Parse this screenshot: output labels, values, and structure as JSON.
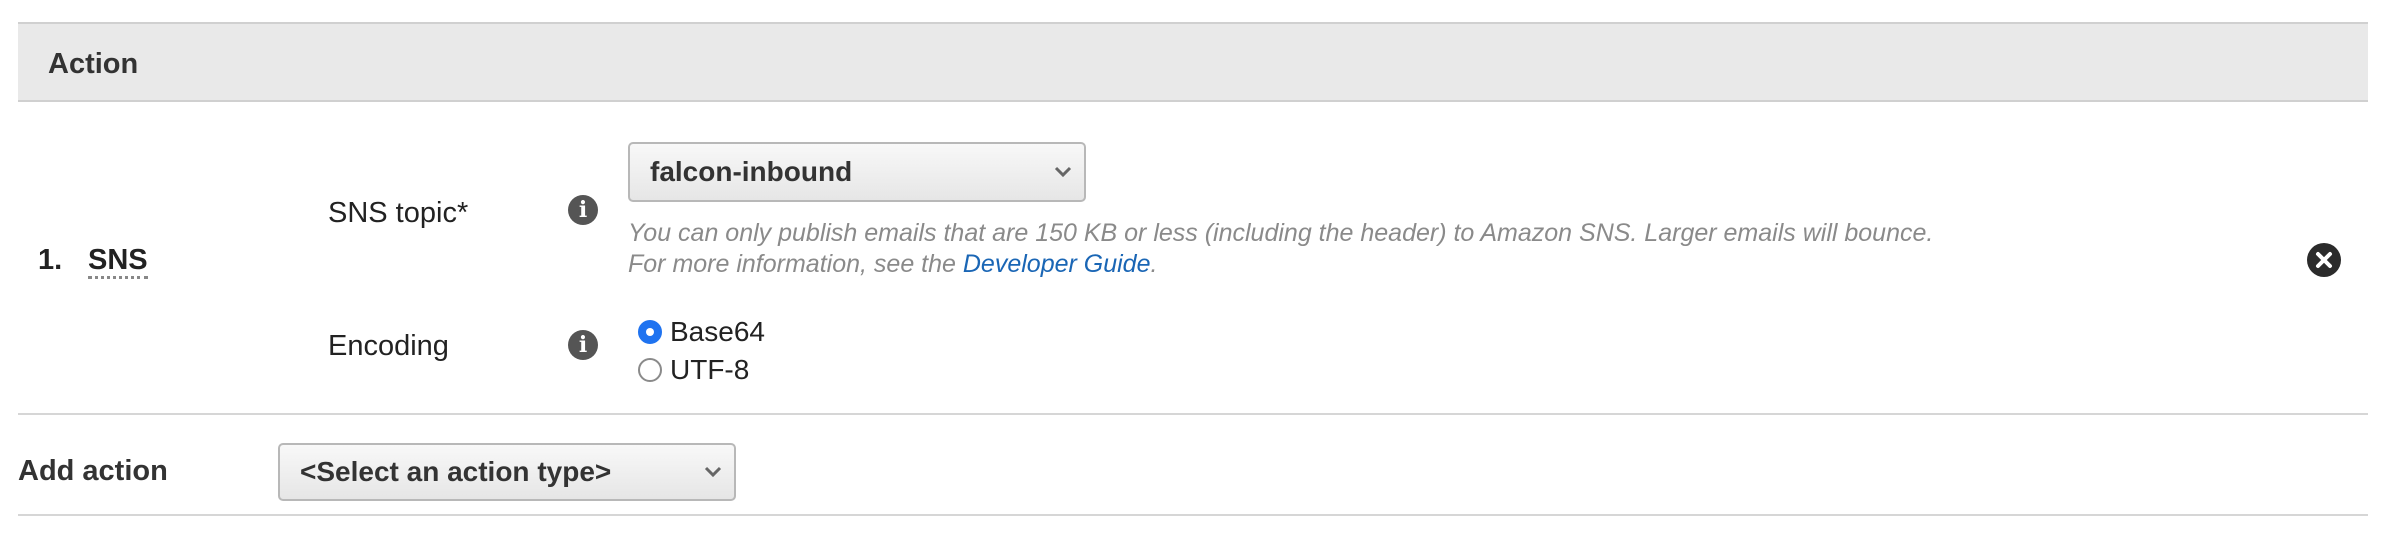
{
  "section": {
    "title": "Action"
  },
  "rule": {
    "index": "1.",
    "type": "SNS",
    "sns_topic": {
      "label": "SNS topic*",
      "selected": "falcon-inbound",
      "help_line1": "You can only publish emails that are 150 KB or less (including the header) to Amazon SNS. Larger emails will bounce.",
      "help_line2_prefix": "For more information, see the",
      "help_link": "Developer Guide",
      "help_line2_suffix": "."
    },
    "encoding": {
      "label": "Encoding",
      "options": [
        {
          "label": "Base64",
          "checked": true
        },
        {
          "label": "UTF-8",
          "checked": false
        }
      ]
    }
  },
  "add_action": {
    "label": "Add action",
    "placeholder": "<Select an action type>"
  },
  "icons": {
    "info": "info-icon",
    "remove": "close-circle-icon",
    "dropdown": "chevron-down-icon"
  },
  "colors": {
    "header_bg": "#e9e9e9",
    "link": "#1a66b5",
    "radio_checked": "#1f73f0"
  }
}
